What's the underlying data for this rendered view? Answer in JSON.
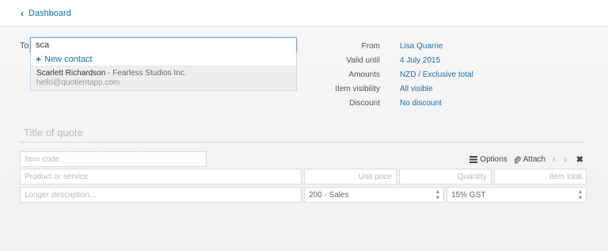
{
  "nav": {
    "back_label": "Dashboard"
  },
  "to": {
    "label": "To",
    "value": "sca"
  },
  "autocomplete": {
    "new_contact_label": "New contact",
    "suggestion": {
      "name": "Scarlett Richardson",
      "separator": " - ",
      "company": "Fearless Studios Inc.",
      "email": "hello@quotientapp.com"
    }
  },
  "meta": {
    "from_label": "From",
    "from_value": "Lisa Quarrie",
    "valid_label": "Valid until",
    "valid_value": "4 July 2015",
    "amounts_label": "Amounts",
    "amounts_value": "NZD / Exclusive total",
    "visibility_label": "Item visibility",
    "visibility_value": "All visible",
    "discount_label": "Discount",
    "discount_value": "No discount"
  },
  "quote": {
    "title_placeholder": "Title of quote"
  },
  "item": {
    "code_placeholder": "Item code",
    "product_placeholder": "Product or service",
    "unit_price_placeholder": "Unit price",
    "quantity_placeholder": "Quantity",
    "total_placeholder": "Item total",
    "description_placeholder": "Longer description...",
    "account_value": "200 - Sales",
    "tax_value": "15% GST"
  },
  "toolbar": {
    "options_label": "Options",
    "attach_label": "Attach"
  }
}
